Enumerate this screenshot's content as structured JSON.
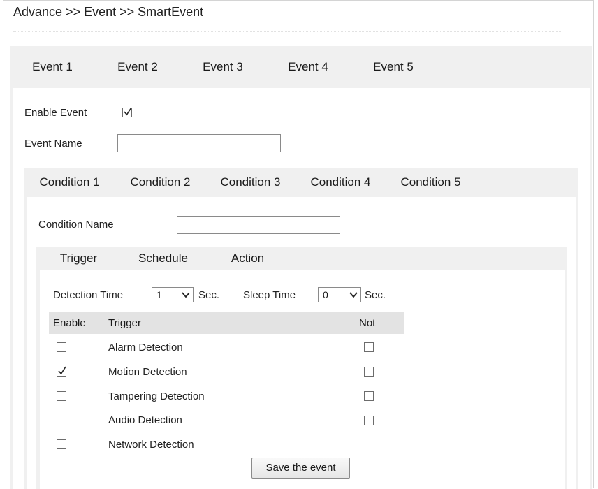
{
  "breadcrumb": "Advance >> Event >> SmartEvent",
  "event_tabs": [
    "Event 1",
    "Event 2",
    "Event 3",
    "Event 4",
    "Event 5"
  ],
  "enable_event": {
    "label": "Enable Event",
    "checked": true
  },
  "event_name": {
    "label": "Event Name",
    "value": ""
  },
  "condition_tabs": [
    "Condition 1",
    "Condition 2",
    "Condition 3",
    "Condition 4",
    "Condition 5"
  ],
  "condition_name": {
    "label": "Condition Name",
    "value": ""
  },
  "sub_tabs": [
    "Trigger",
    "Schedule",
    "Action"
  ],
  "detection": {
    "label": "Detection Time",
    "value": "1",
    "unit": "Sec."
  },
  "sleep": {
    "label": "Sleep Time",
    "value": "0",
    "unit": "Sec."
  },
  "table": {
    "headers": {
      "enable": "Enable",
      "trigger": "Trigger",
      "not": "Not"
    },
    "rows": [
      {
        "name": "Alarm Detection",
        "enabled": false,
        "not": false,
        "has_not": true
      },
      {
        "name": "Motion Detection",
        "enabled": true,
        "not": false,
        "has_not": true
      },
      {
        "name": "Tampering Detection",
        "enabled": false,
        "not": false,
        "has_not": true
      },
      {
        "name": "Audio Detection",
        "enabled": false,
        "not": false,
        "has_not": true
      },
      {
        "name": "Network Detection",
        "enabled": false,
        "not": false,
        "has_not": false
      }
    ]
  },
  "save_button": "Save the event"
}
